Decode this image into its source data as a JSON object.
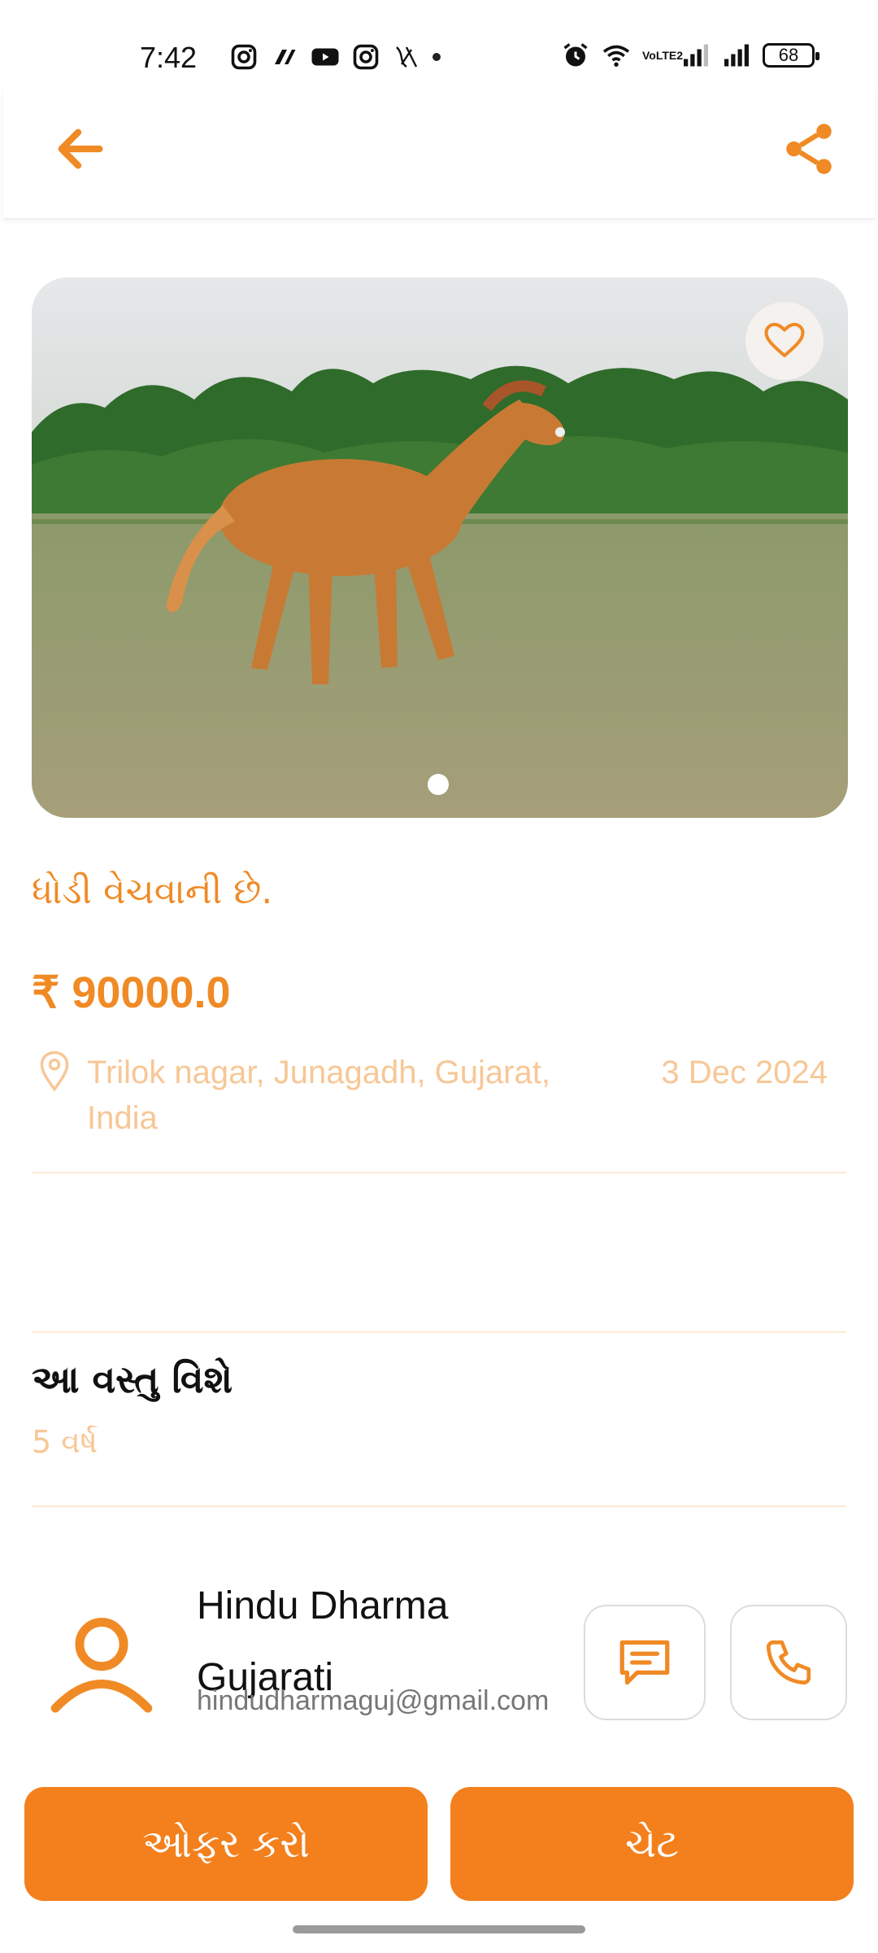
{
  "status_bar": {
    "time": "7:42",
    "battery": "68",
    "network_label": "VoLTE2",
    "icons_left": [
      "instagram-icon",
      "tally-icon",
      "youtube-icon",
      "instagram-icon",
      "scribble-icon",
      "dot-icon"
    ],
    "icons_right": [
      "alarm-icon",
      "wifi-icon",
      "volte-icon",
      "signal-icon",
      "signal-icon",
      "battery-icon"
    ]
  },
  "header": {
    "back_icon": "arrow-left-icon",
    "share_icon": "share-icon"
  },
  "listing": {
    "image_alt": "Chestnut horse running in a grassy field",
    "title": "ધોડી વેચવાની છે.",
    "price": "₹ 90000.0",
    "location": "Trilok nagar, Junagadh, Gujarat, India",
    "date": "3 Dec 2024"
  },
  "about": {
    "heading": "આ વસ્તુ વિશે",
    "description": "5 વર્ષ"
  },
  "seller": {
    "name": "Hindu Dharma Gujarati",
    "email": "hindudharmaguj@gmail.com"
  },
  "actions": {
    "offer_label": "ઓફર કરો",
    "chat_label": "ચેટ"
  },
  "colors": {
    "accent": "#f3801d",
    "muted_accent": "#f7c796",
    "divider": "#fde9d6"
  }
}
